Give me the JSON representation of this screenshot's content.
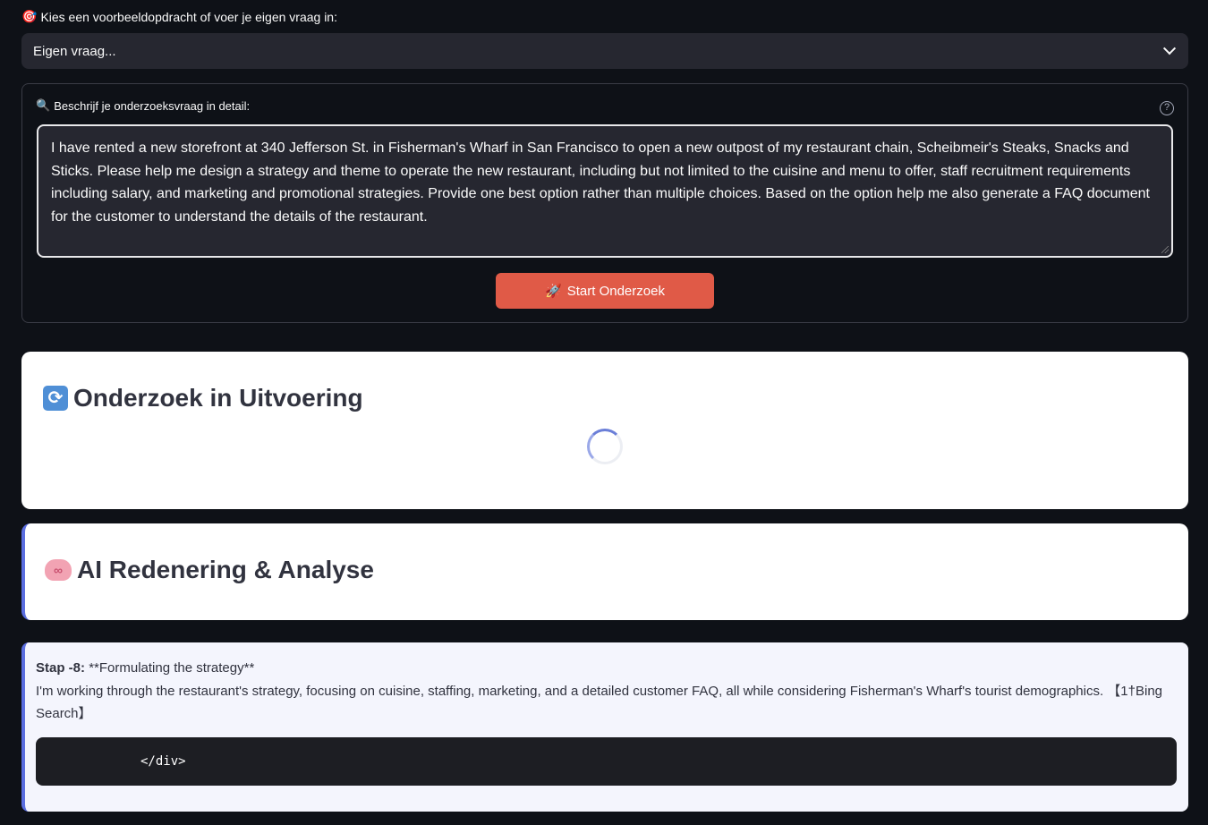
{
  "select": {
    "label_icon": "dart-icon",
    "label_emoji": "🎯",
    "label": "Kies een voorbeeldopdracht of voer je eigen vraag in:",
    "value": "Eigen vraag..."
  },
  "form": {
    "label_icon": "magnifier-icon",
    "label_emoji": "🔍",
    "label": "Beschrijf je onderzoeksvraag in detail:",
    "help_glyph": "?",
    "textarea_value": "I have rented a new storefront at 340 Jefferson St. in Fisherman's Wharf in San Francisco to open a new outpost of my restaurant chain, Scheibmeir's Steaks, Snacks and Sticks. Please help me design a strategy and theme to operate the new restaurant, including but not limited to the cuisine and menu to offer, staff recruitment requirements including salary, and marketing and promotional strategies. Provide one best option rather than multiple choices. Based on the option help me also generate a FAQ document for the customer to understand the details of the restaurant.",
    "button_emoji": "🚀",
    "button_label": "Start Onderzoek"
  },
  "progress": {
    "icon": "refresh-icon",
    "emoji": "🔄",
    "title": "Onderzoek in Uitvoering"
  },
  "analysis": {
    "icon": "brain-icon",
    "emoji": "🧠",
    "title": "AI Redenering & Analyse"
  },
  "step": {
    "label": "Stap -8:",
    "heading": "**Formulating the strategy**",
    "body": "I'm working through the restaurant's strategy, focusing on cuisine, staffing, marketing, and a detailed customer FAQ, all while considering Fisherman's Wharf's tourist demographics. 【1†Bing Search】",
    "code": "</div>"
  },
  "colors": {
    "background": "#0e1117",
    "input_bg": "#262730",
    "primary_button": "#e05a47",
    "accent": "#5b6ee0",
    "step_bg": "#f4f5fd"
  }
}
